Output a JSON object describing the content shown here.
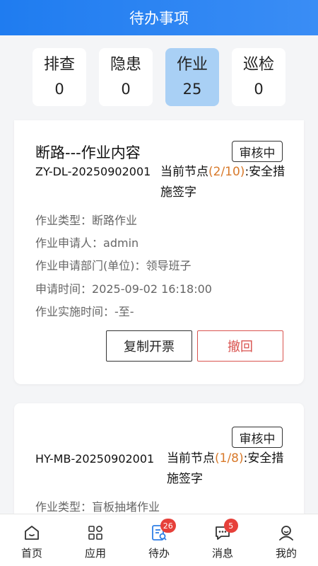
{
  "header": {
    "title": "待办事项"
  },
  "tabs": [
    {
      "label": "排查",
      "count": "0"
    },
    {
      "label": "隐患",
      "count": "0"
    },
    {
      "label": "作业",
      "count": "25"
    },
    {
      "label": "巡检",
      "count": "0"
    }
  ],
  "cards": [
    {
      "title": "断路---作业内容",
      "status": "审核中",
      "code": "ZY-DL-20250902001",
      "node_prefix": "当前节点",
      "node_progress": "(2/10)",
      "node_name": ":安全措施签字",
      "fields": [
        {
          "label": "作业类型：",
          "value": "断路作业"
        },
        {
          "label": "作业申请人：",
          "value": "admin"
        },
        {
          "label": "作业申请部门(单位)：",
          "value": "领导班子"
        },
        {
          "label": "申请时间：",
          "value": "2025-09-02 16:18:00"
        },
        {
          "label": "作业实施时间：",
          "value": "-至-"
        }
      ],
      "actions": {
        "copy": "复制开票",
        "revoke": "撤回"
      }
    },
    {
      "title": "",
      "status": "审核中",
      "code": "HY-MB-20250902001",
      "node_prefix": "当前节点",
      "node_progress": "(1/8)",
      "node_name": ":安全措施签字",
      "fields": [
        {
          "label": "作业类型：",
          "value": "盲板抽堵作业"
        }
      ]
    }
  ],
  "bottom_nav": [
    {
      "label": "首页",
      "icon": "home-icon"
    },
    {
      "label": "应用",
      "icon": "apps-grid-icon"
    },
    {
      "label": "待办",
      "icon": "todo-icon",
      "badge": "26"
    },
    {
      "label": "消息",
      "icon": "message-icon",
      "badge": "5"
    },
    {
      "label": "我的",
      "icon": "profile-icon"
    }
  ],
  "colors": {
    "header": "#1f7cf0",
    "active_tab": "#a9d0f5",
    "accent_orange": "#d8792a",
    "revoke_red": "#d9534f",
    "badge_red": "#e6403a"
  }
}
